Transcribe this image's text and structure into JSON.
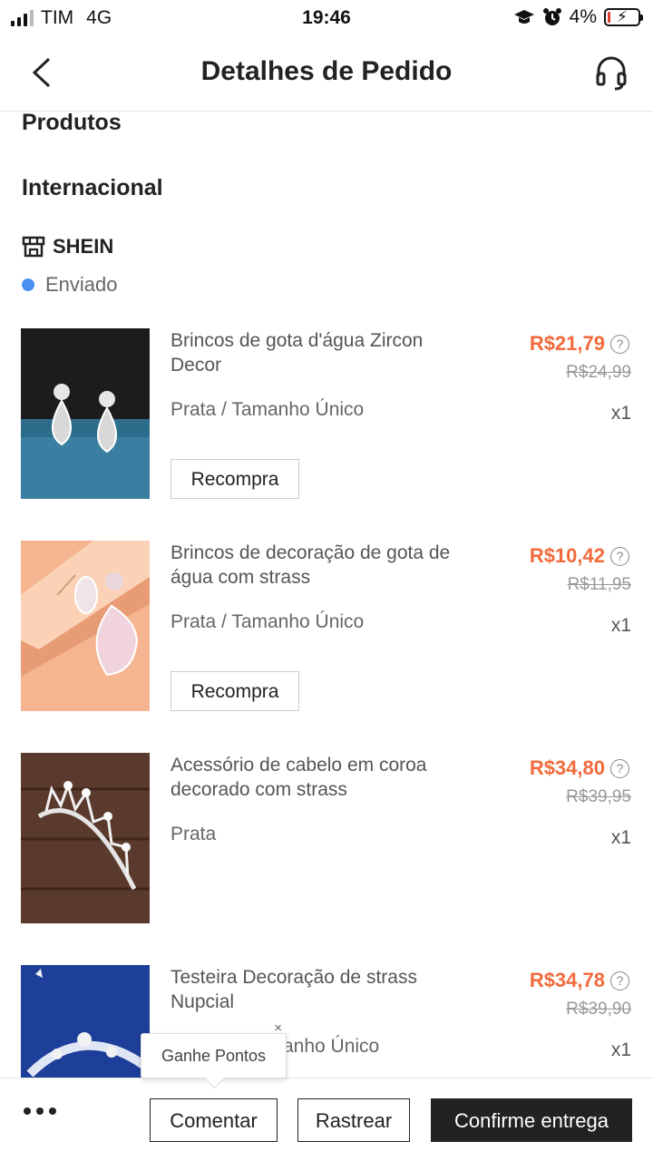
{
  "status_bar": {
    "carrier": "TIM",
    "network": "4G",
    "time": "19:46",
    "battery": "4%"
  },
  "header": {
    "title": "Detalhes de Pedido"
  },
  "sections": {
    "products": "Produtos",
    "international": "Internacional"
  },
  "store": {
    "name": "SHEIN",
    "status": "Enviado"
  },
  "products": [
    {
      "name": "Brincos de gota d'água Zircon Decor",
      "variant": "Prata / Tamanho Único",
      "price": "R$21,79",
      "old_price": "R$24,99",
      "qty": "x1",
      "rebuy": "Recompra"
    },
    {
      "name": "Brincos de decoração de gota de água com strass",
      "variant": "Prata / Tamanho Único",
      "price": "R$10,42",
      "old_price": "R$11,95",
      "qty": "x1",
      "rebuy": "Recompra"
    },
    {
      "name": "Acessório de cabelo em coroa decorado com strass",
      "variant": "Prata",
      "price": "R$34,80",
      "old_price": "R$39,95",
      "qty": "x1"
    },
    {
      "name": "Testeira Decoração de strass Nupcial",
      "variant": "anho Único",
      "price": "R$34,78",
      "old_price": "R$39,90",
      "qty": "x1"
    }
  ],
  "tooltip": {
    "text": "Ganhe Pontos",
    "close": "×"
  },
  "actions": {
    "comment": "Comentar",
    "track": "Rastrear",
    "confirm": "Confirme entrega"
  },
  "colors": {
    "price": "#f26a3b",
    "status_dot": "#4a90f0",
    "primary_button": "#222222"
  }
}
